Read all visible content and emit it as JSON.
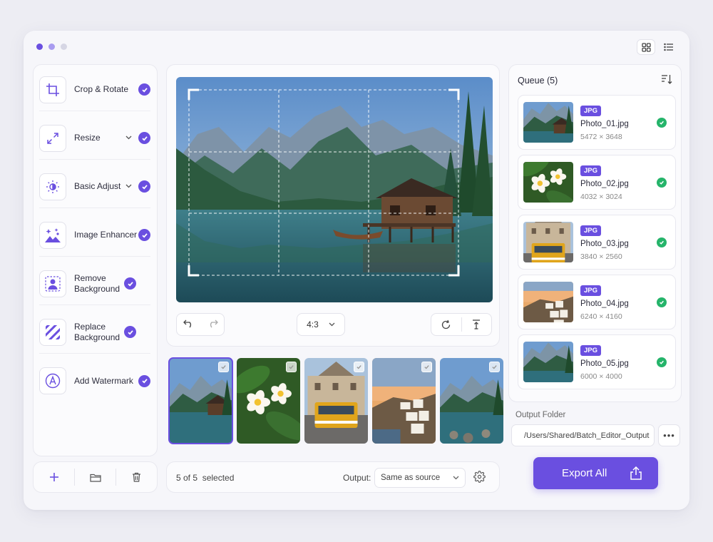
{
  "window": {
    "dot_colors": [
      "#6a4fe0",
      "#a99cf0",
      "#d6d6e4"
    ]
  },
  "view_toggle": {
    "grid_icon": "grid-icon",
    "list_icon": "list-icon",
    "active": "grid"
  },
  "tools": [
    {
      "label": "Crop & Rotate",
      "icon": "crop-icon",
      "has_dropdown": false,
      "checked": true
    },
    {
      "label": "Resize",
      "icon": "resize-icon",
      "has_dropdown": true,
      "checked": true
    },
    {
      "label": "Basic Adjust",
      "icon": "brightness-icon",
      "has_dropdown": true,
      "checked": true
    },
    {
      "label": "Image Enhancer",
      "icon": "sparkle-image-icon",
      "has_dropdown": false,
      "checked": true
    },
    {
      "label": "Remove Background",
      "icon": "person-remove-bg-icon",
      "has_dropdown": false,
      "checked": true
    },
    {
      "label": "Replace Background",
      "icon": "stripes-icon",
      "has_dropdown": false,
      "checked": true
    },
    {
      "label": "Add Watermark",
      "icon": "watermark-a-icon",
      "has_dropdown": false,
      "checked": true
    }
  ],
  "tools_footer": {
    "add_icon": "plus-icon",
    "folder_icon": "folder-icon",
    "delete_icon": "trash-icon"
  },
  "preview": {
    "aspect_ratio": "4:3",
    "undo_icon": "undo-icon",
    "redo_icon": "redo-icon",
    "rotate_icon": "rotate-icon",
    "align_icon": "align-top-icon"
  },
  "thumbnails": [
    {
      "scene": "lake",
      "selected": true
    },
    {
      "scene": "flowers",
      "selected": false
    },
    {
      "scene": "tram",
      "selected": false
    },
    {
      "scene": "coast",
      "selected": false
    },
    {
      "scene": "lake2",
      "selected": false
    }
  ],
  "bottom_bar": {
    "selection_text": "5 of 5  selected",
    "output_label": "Output:",
    "output_value": "Same as source"
  },
  "queue": {
    "title": "Queue (5)",
    "items": [
      {
        "format": "JPG",
        "name": "Photo_01.jpg",
        "size": "5472 × 3648",
        "scene": "lake",
        "status": "done"
      },
      {
        "format": "JPG",
        "name": "Photo_02.jpg",
        "size": "4032 × 3024",
        "scene": "flowers",
        "status": "done"
      },
      {
        "format": "JPG",
        "name": "Photo_03.jpg",
        "size": "3840 × 2560",
        "scene": "tram",
        "status": "done"
      },
      {
        "format": "JPG",
        "name": "Photo_04.jpg",
        "size": "6240 × 4160",
        "scene": "coast",
        "status": "done"
      },
      {
        "format": "JPG",
        "name": "Photo_05.jpg",
        "size": "6000 × 4000",
        "scene": "lake2",
        "status": "done"
      }
    ]
  },
  "output_folder": {
    "label": "Output Folder",
    "path": "/Users/Shared/Batch_Editor_Output",
    "more_label": "•••"
  },
  "export_button": {
    "label": "Export All",
    "icon": "share-upload-icon"
  },
  "colors": {
    "accent": "#6a4fe0",
    "success": "#25b46a",
    "background": "#f6f6fa"
  }
}
